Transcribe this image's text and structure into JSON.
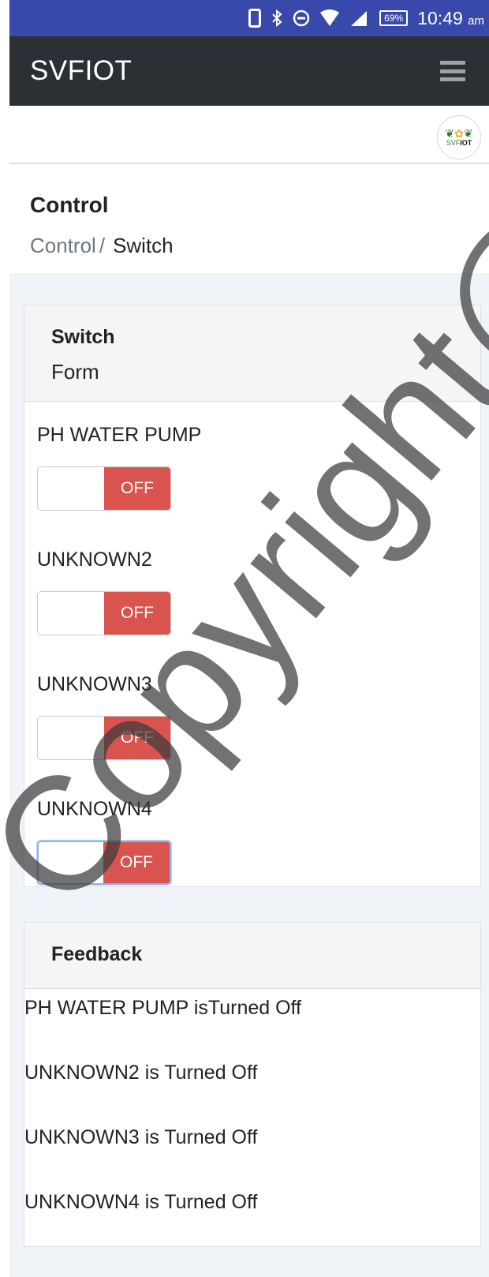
{
  "status_bar": {
    "battery": "69%",
    "time": "10:49",
    "ampm": "am"
  },
  "navbar": {
    "brand": "SVFIOT"
  },
  "logo": {
    "text": "SVFIOT"
  },
  "page_header": {
    "title": "Control",
    "breadcrumb": [
      "Control",
      "Switch"
    ],
    "separator": "/"
  },
  "switch_card": {
    "title": "Switch",
    "subtitle": "Form",
    "switches": [
      {
        "label": "PH WATER PUMP",
        "state": "OFF"
      },
      {
        "label": "UNKNOWN2",
        "state": "OFF"
      },
      {
        "label": "UNKNOWN3",
        "state": "OFF"
      },
      {
        "label": "UNKNOWN4",
        "state": "OFF"
      }
    ]
  },
  "feedback_card": {
    "title": "Feedback",
    "items": [
      "PH WATER PUMP isTurned Off",
      "UNKNOWN2 is Turned Off",
      "UNKNOWN3 is Turned Off",
      "UNKNOWN4 is Turned Off"
    ]
  },
  "watermark": "Copyright@FT",
  "colors": {
    "status_bar": "#3949ab",
    "navbar": "#2b3035",
    "toggle_off": "#d9534f",
    "content_bg": "#f0f3f8"
  }
}
